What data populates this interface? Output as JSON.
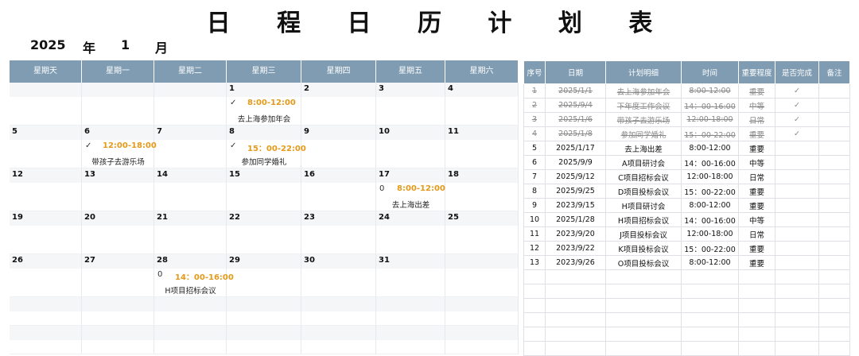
{
  "title": "日 程 日 历 计 划 表",
  "year": "2025",
  "year_unit": "年",
  "month": "1",
  "month_unit": "月",
  "calendar": {
    "weekdays": [
      "星期天",
      "星期一",
      "星期二",
      "星期三",
      "星期四",
      "星期五",
      "星期六"
    ],
    "weeks": [
      [
        {
          "day": ""
        },
        {
          "day": ""
        },
        {
          "day": ""
        },
        {
          "day": "1",
          "mark": "✓",
          "time": "8:00-12:00",
          "event": "去上海参加年会"
        },
        {
          "day": "2"
        },
        {
          "day": "3"
        },
        {
          "day": "4"
        }
      ],
      [
        {
          "day": "5"
        },
        {
          "day": "6",
          "mark": "✓",
          "time": "12:00-18:00",
          "event": "带孩子去游乐场"
        },
        {
          "day": "7"
        },
        {
          "day": "8",
          "mark": "✓",
          "time": "15：00-22:00",
          "event": "参加同学婚礼"
        },
        {
          "day": "9"
        },
        {
          "day": "10"
        },
        {
          "day": "11"
        }
      ],
      [
        {
          "day": "12"
        },
        {
          "day": "13"
        },
        {
          "day": "14"
        },
        {
          "day": "15"
        },
        {
          "day": "16"
        },
        {
          "day": "17",
          "mark": "0",
          "time": "8:00-12:00",
          "event": "去上海出差"
        },
        {
          "day": "18"
        }
      ],
      [
        {
          "day": "19"
        },
        {
          "day": "20"
        },
        {
          "day": "21"
        },
        {
          "day": "22"
        },
        {
          "day": "23"
        },
        {
          "day": "24"
        },
        {
          "day": "25"
        }
      ],
      [
        {
          "day": "26"
        },
        {
          "day": "27"
        },
        {
          "day": "28",
          "mark": "0",
          "time": "14：00-16:00",
          "event": "H项目招标会议"
        },
        {
          "day": "29"
        },
        {
          "day": "30"
        },
        {
          "day": "31"
        },
        {
          "day": ""
        }
      ]
    ]
  },
  "schedule": {
    "headers": [
      "序号",
      "日期",
      "计划明细",
      "时间",
      "重要程度",
      "是否完成",
      "备注"
    ],
    "rows": [
      {
        "no": "1",
        "date": "2025/1/1",
        "detail": "去上海参加年会",
        "time": "8:00-12:00",
        "level": "重要",
        "done": "✓",
        "note": "",
        "completed": true
      },
      {
        "no": "2",
        "date": "2025/9/4",
        "detail": "下年度工作会议",
        "time": "14：00-16:00",
        "level": "中等",
        "done": "✓",
        "note": "",
        "completed": true
      },
      {
        "no": "3",
        "date": "2025/1/6",
        "detail": "带孩子去游乐场",
        "time": "12:00-18:00",
        "level": "日常",
        "done": "✓",
        "note": "",
        "completed": true
      },
      {
        "no": "4",
        "date": "2025/1/8",
        "detail": "参加同学婚礼",
        "time": "15：00-22:00",
        "level": "重要",
        "done": "✓",
        "note": "",
        "completed": true
      },
      {
        "no": "5",
        "date": "2025/1/17",
        "detail": "去上海出差",
        "time": "8:00-12:00",
        "level": "重要",
        "done": "",
        "note": "",
        "completed": false
      },
      {
        "no": "6",
        "date": "2025/9/9",
        "detail": "A项目研讨会",
        "time": "14：00-16:00",
        "level": "中等",
        "done": "",
        "note": "",
        "completed": false
      },
      {
        "no": "7",
        "date": "2025/9/12",
        "detail": "C项目招标会议",
        "time": "12:00-18:00",
        "level": "日常",
        "done": "",
        "note": "",
        "completed": false
      },
      {
        "no": "8",
        "date": "2025/9/25",
        "detail": "D项目投标会议",
        "time": "15：00-22:00",
        "level": "重要",
        "done": "",
        "note": "",
        "completed": false
      },
      {
        "no": "9",
        "date": "2023/9/15",
        "detail": "H项目研讨会",
        "time": "8:00-12:00",
        "level": "重要",
        "done": "",
        "note": "",
        "completed": false
      },
      {
        "no": "10",
        "date": "2025/1/28",
        "detail": "H项目招标会议",
        "time": "14：00-16:00",
        "level": "中等",
        "done": "",
        "note": "",
        "completed": false
      },
      {
        "no": "11",
        "date": "2023/9/20",
        "detail": "J项目投标会议",
        "time": "12:00-18:00",
        "level": "日常",
        "done": "",
        "note": "",
        "completed": false
      },
      {
        "no": "12",
        "date": "2023/9/22",
        "detail": "K项目投标会议",
        "time": "15：00-22:00",
        "level": "重要",
        "done": "",
        "note": "",
        "completed": false
      },
      {
        "no": "13",
        "date": "2023/9/26",
        "detail": "O项目投标会议",
        "time": "8:00-12:00",
        "level": "重要",
        "done": "",
        "note": "",
        "completed": false
      }
    ],
    "empty_rows": 6
  },
  "colors": {
    "header_bg": "#7f9cb2",
    "time_accent": "#e39a1a"
  }
}
